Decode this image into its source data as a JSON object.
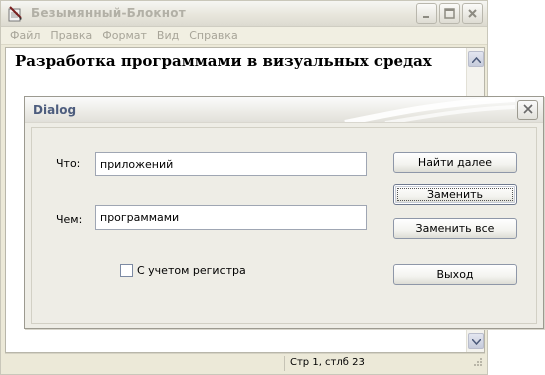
{
  "notepad": {
    "title": "Безымянный-Блокнот",
    "menu": [
      "Файл",
      "Правка",
      "Формат",
      "Вид",
      "Справка"
    ],
    "editor_text": "Разработка программами в визуальных средах",
    "status": "Стр 1, стлб 23"
  },
  "dialog": {
    "title": "Dialog",
    "find_label": "Что:",
    "find_value": "приложений",
    "replace_label": "Чем:",
    "replace_value": "программами",
    "match_case_label": "С учетом регистра",
    "match_case_checked": false,
    "buttons": {
      "find_next": "Найти далее",
      "replace": "Заменить",
      "replace_all": "Заменить все",
      "exit": "Выход"
    }
  },
  "icons": {
    "app": "notepad-icon",
    "minimize": "minimize-icon",
    "maximize": "maximize-icon",
    "close": "close-icon",
    "scroll_up": "arrow-up-icon",
    "scroll_down": "arrow-down-icon",
    "resize": "resize-grip-icon"
  },
  "colors": {
    "dialog_title": "#4d5d7e",
    "disabled_text": "#a7a498",
    "window_face": "#ece9d8"
  }
}
